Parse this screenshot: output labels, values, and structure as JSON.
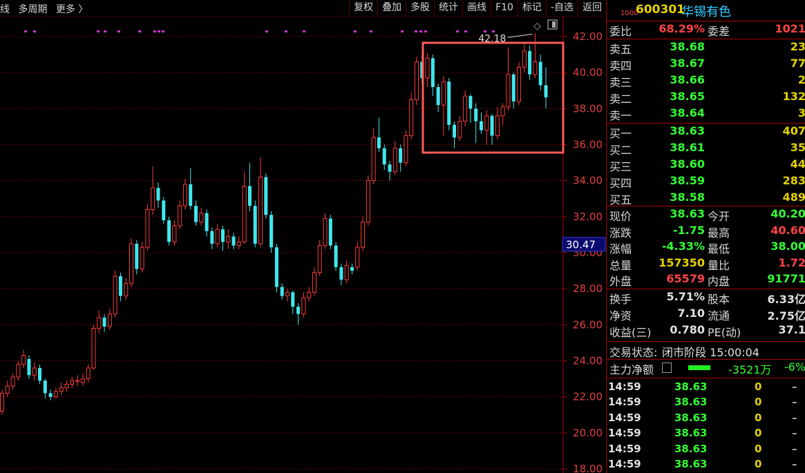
{
  "toolbar": {
    "left_items": [
      "线",
      "多周期",
      "更多 〉"
    ],
    "buttons": [
      "复权",
      "叠加",
      "多股",
      "统计",
      "画线",
      "F10",
      "标记",
      "-自选",
      "返回"
    ]
  },
  "chart_data": {
    "type": "candlestick",
    "y_ticks": [
      "42.00",
      "40.00",
      "38.00",
      "36.00",
      "34.00",
      "32.00",
      "30.00",
      "28.00",
      "26.00",
      "24.00",
      "22.00",
      "20.00",
      "18.00"
    ],
    "ylim": [
      18,
      42.5
    ],
    "high_marker": "42.18",
    "crosshair_value": "30.47",
    "candles": [
      [
        21.2,
        22.2,
        21.0,
        22.4
      ],
      [
        22.2,
        22.6,
        22.0,
        22.9
      ],
      [
        22.6,
        23.1,
        22.4,
        23.3
      ],
      [
        23.1,
        23.8,
        22.9,
        24.0
      ],
      [
        23.8,
        24.3,
        23.6,
        24.6
      ],
      [
        24.1,
        23.2,
        23.0,
        24.3
      ],
      [
        23.2,
        23.6,
        22.9,
        23.9
      ],
      [
        23.6,
        22.9,
        22.7,
        23.8
      ],
      [
        22.9,
        22.2,
        21.9,
        23.0
      ],
      [
        22.2,
        22.0,
        21.8,
        22.4
      ],
      [
        22.0,
        22.3,
        21.9,
        22.5
      ],
      [
        22.3,
        22.5,
        22.1,
        22.8
      ],
      [
        22.5,
        22.7,
        22.3,
        22.9
      ],
      [
        22.7,
        22.9,
        22.5,
        23.1
      ],
      [
        22.9,
        22.9,
        22.6,
        23.2
      ],
      [
        22.8,
        23.0,
        22.6,
        23.3
      ],
      [
        23.0,
        23.6,
        22.8,
        23.8
      ],
      [
        23.6,
        25.8,
        23.5,
        26.0
      ],
      [
        25.8,
        26.4,
        25.5,
        26.8
      ],
      [
        26.4,
        25.9,
        25.6,
        26.6
      ],
      [
        25.9,
        26.6,
        25.7,
        26.9
      ],
      [
        26.6,
        28.7,
        26.4,
        29.0
      ],
      [
        28.7,
        27.6,
        27.3,
        28.9
      ],
      [
        27.6,
        28.3,
        27.4,
        28.6
      ],
      [
        28.3,
        30.5,
        28.1,
        30.8
      ],
      [
        30.5,
        29.1,
        28.8,
        30.7
      ],
      [
        29.1,
        30.3,
        28.9,
        30.6
      ],
      [
        30.3,
        32.4,
        30.1,
        32.7
      ],
      [
        32.4,
        33.6,
        32.1,
        34.8
      ],
      [
        33.6,
        32.9,
        32.5,
        33.9
      ],
      [
        32.9,
        31.8,
        31.6,
        33.1
      ],
      [
        31.8,
        30.6,
        30.4,
        32.0
      ],
      [
        30.6,
        31.5,
        30.4,
        31.8
      ],
      [
        31.5,
        32.6,
        31.3,
        32.9
      ],
      [
        32.6,
        33.8,
        32.4,
        34.1
      ],
      [
        33.8,
        32.6,
        32.4,
        34.7
      ],
      [
        32.6,
        31.7,
        31.5,
        32.9
      ],
      [
        31.7,
        32.2,
        31.5,
        32.5
      ],
      [
        32.2,
        31.2,
        30.9,
        32.4
      ],
      [
        31.2,
        30.5,
        30.2,
        31.4
      ],
      [
        30.5,
        31.3,
        30.3,
        31.6
      ],
      [
        31.3,
        30.6,
        30.1,
        31.5
      ],
      [
        30.6,
        30.9,
        30.2,
        31.3
      ],
      [
        30.9,
        30.4,
        30.2,
        31.1
      ],
      [
        30.4,
        30.6,
        30.2,
        30.9
      ],
      [
        30.6,
        33.7,
        30.5,
        34.5
      ],
      [
        33.7,
        32.6,
        32.3,
        35.0
      ],
      [
        32.6,
        30.5,
        30.3,
        32.9
      ],
      [
        30.5,
        34.2,
        30.3,
        35.3
      ],
      [
        34.2,
        32.1,
        31.9,
        34.4
      ],
      [
        32.1,
        30.3,
        30.0,
        32.3
      ],
      [
        30.3,
        28.1,
        27.8,
        30.5
      ],
      [
        28.1,
        27.6,
        27.4,
        28.3
      ],
      [
        27.6,
        27.8,
        27.3,
        28.0
      ],
      [
        27.8,
        27.0,
        26.6,
        27.9
      ],
      [
        27.0,
        26.6,
        26.0,
        27.2
      ],
      [
        26.6,
        27.5,
        26.4,
        27.8
      ],
      [
        27.5,
        27.8,
        27.3,
        28.1
      ],
      [
        27.8,
        28.9,
        27.6,
        29.2
      ],
      [
        28.9,
        30.4,
        28.7,
        30.7
      ],
      [
        30.4,
        31.9,
        30.2,
        32.2
      ],
      [
        31.9,
        30.4,
        30.2,
        32.1
      ],
      [
        30.4,
        29.2,
        29.0,
        30.6
      ],
      [
        29.2,
        28.5,
        28.2,
        29.4
      ],
      [
        28.5,
        29.3,
        28.3,
        29.6
      ],
      [
        29.2,
        29.0,
        28.8,
        29.4
      ],
      [
        29.2,
        30.3,
        29.0,
        30.6
      ],
      [
        30.3,
        31.7,
        30.1,
        32.0
      ],
      [
        31.7,
        34.0,
        31.5,
        34.3
      ],
      [
        34.0,
        36.4,
        33.8,
        36.9
      ],
      [
        36.4,
        35.8,
        35.6,
        37.5
      ],
      [
        35.8,
        34.9,
        34.6,
        36.0
      ],
      [
        34.9,
        34.5,
        34.0,
        35.1
      ],
      [
        34.5,
        35.8,
        34.3,
        36.2
      ],
      [
        35.8,
        35.0,
        34.5,
        36.0
      ],
      [
        35.0,
        36.5,
        34.8,
        36.8
      ],
      [
        36.5,
        38.5,
        36.3,
        38.9
      ],
      [
        38.5,
        40.6,
        38.2,
        40.9
      ],
      [
        40.6,
        39.7,
        39.4,
        41.0
      ],
      [
        39.7,
        40.8,
        39.2,
        41.1
      ],
      [
        40.8,
        39.2,
        38.7,
        41.0
      ],
      [
        39.2,
        38.2,
        37.8,
        39.4
      ],
      [
        38.2,
        39.5,
        36.5,
        39.8
      ],
      [
        39.5,
        37.1,
        36.8,
        39.7
      ],
      [
        37.1,
        36.4,
        35.8,
        37.3
      ],
      [
        36.4,
        37.3,
        36.2,
        37.6
      ],
      [
        37.3,
        38.7,
        37.0,
        39.0
      ],
      [
        38.7,
        38.0,
        37.2,
        38.8
      ],
      [
        38.0,
        37.3,
        36.1,
        38.3
      ],
      [
        37.3,
        36.8,
        36.6,
        37.8
      ],
      [
        36.8,
        37.6,
        36.0,
        37.9
      ],
      [
        37.6,
        36.5,
        36.0,
        37.7
      ],
      [
        36.5,
        37.6,
        36.3,
        38.1
      ],
      [
        37.6,
        38.1,
        37.1,
        38.3
      ],
      [
        38.1,
        39.9,
        37.9,
        41.4
      ],
      [
        39.9,
        38.4,
        38.0,
        40.0
      ],
      [
        38.4,
        40.3,
        38.2,
        40.6
      ],
      [
        40.3,
        41.2,
        40.0,
        41.6
      ],
      [
        41.2,
        39.9,
        39.6,
        41.5
      ],
      [
        39.9,
        40.6,
        39.7,
        42.18
      ],
      [
        40.6,
        39.3,
        39.0,
        41.0
      ],
      [
        39.3,
        38.63,
        38.0,
        40.3
      ]
    ]
  },
  "quote": {
    "code": "600301",
    "name": "华锡有色",
    "badge": "1000",
    "weibi_label": "委比",
    "weibi_value": "68.29%",
    "weicha_label": "委差",
    "weicha_value": "1021",
    "sells": [
      {
        "label": "卖五",
        "price": "38.68",
        "vol": "23"
      },
      {
        "label": "卖四",
        "price": "38.67",
        "vol": "77"
      },
      {
        "label": "卖三",
        "price": "38.66",
        "vol": "2"
      },
      {
        "label": "卖二",
        "price": "38.65",
        "vol": "132"
      },
      {
        "label": "卖一",
        "price": "38.64",
        "vol": "3"
      }
    ],
    "buys": [
      {
        "label": "买一",
        "price": "38.63",
        "vol": "407"
      },
      {
        "label": "买二",
        "price": "38.61",
        "vol": "35"
      },
      {
        "label": "买三",
        "price": "38.60",
        "vol": "44"
      },
      {
        "label": "买四",
        "price": "38.59",
        "vol": "283"
      },
      {
        "label": "买五",
        "price": "38.58",
        "vol": "489"
      }
    ],
    "stats": [
      {
        "l1": "现价",
        "v1": "38.63",
        "c1": "green",
        "l2": "今开",
        "v2": "40.20",
        "c2": "green"
      },
      {
        "l1": "涨跌",
        "v1": "-1.75",
        "c1": "green",
        "l2": "最高",
        "v2": "40.60",
        "c2": "red"
      },
      {
        "l1": "涨幅",
        "v1": "-4.33%",
        "c1": "green",
        "l2": "最低",
        "v2": "38.00",
        "c2": "green"
      },
      {
        "l1": "总量",
        "v1": "157350",
        "c1": "yellow",
        "l2": "量比",
        "v2": "1.72",
        "c2": "red"
      },
      {
        "l1": "外盘",
        "v1": "65579",
        "c1": "red",
        "l2": "内盘",
        "v2": "91771",
        "c2": "green"
      }
    ],
    "stats2": [
      {
        "l1": "换手",
        "v1": "5.71%",
        "l2": "股本",
        "v2": "6.33亿"
      },
      {
        "l1": "净资",
        "v1": "7.10",
        "l2": "流通",
        "v2": "2.75亿"
      },
      {
        "l1": "收益(三)",
        "v1": "0.780",
        "l2": "PE(动)",
        "v2": "37.1"
      }
    ],
    "status_label": "交易状态:",
    "status_value": "闭市阶段 15:00:04",
    "main_flow_label": "主力净额",
    "main_flow_value": "-3521万",
    "main_flow_pct": "-6%",
    "ticks": [
      {
        "time": "14:59",
        "price": "38.63",
        "vol": "0",
        "dir": "–"
      },
      {
        "time": "14:59",
        "price": "38.63",
        "vol": "0",
        "dir": "–"
      },
      {
        "time": "14:59",
        "price": "38.63",
        "vol": "0",
        "dir": "–"
      },
      {
        "time": "14:59",
        "price": "38.63",
        "vol": "0",
        "dir": "–"
      },
      {
        "time": "14:59",
        "price": "38.63",
        "vol": "0",
        "dir": "–"
      },
      {
        "time": "14:59",
        "price": "38.63",
        "vol": "0",
        "dir": "–"
      }
    ]
  },
  "colors": {
    "up": "#ff3c3c",
    "down": "#3fe8ec",
    "grid": "#7a0000",
    "highlight_box": "#ff5a5a",
    "marker": "#d030d0"
  }
}
